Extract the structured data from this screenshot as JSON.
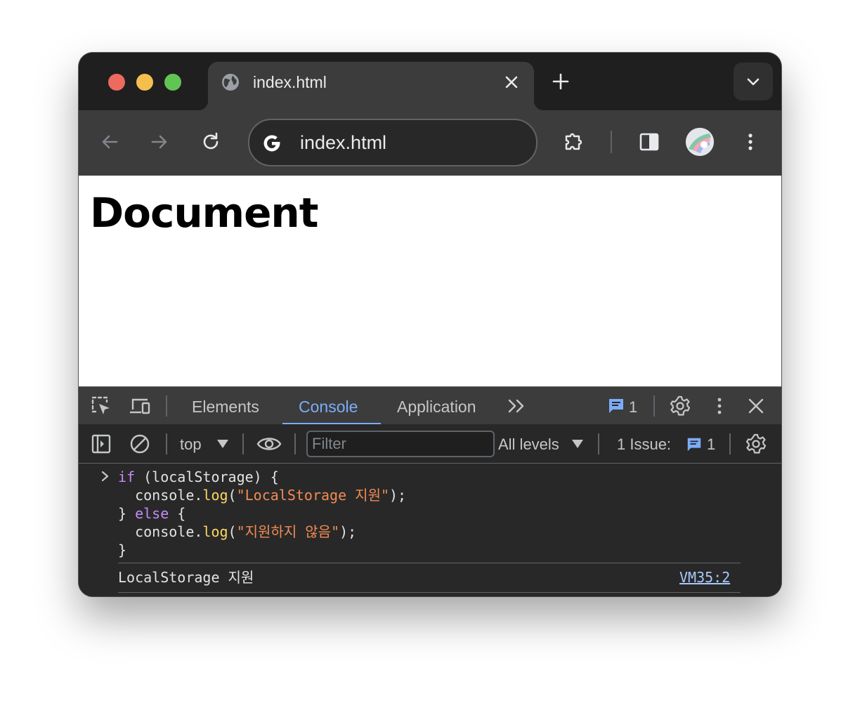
{
  "browser": {
    "tab": {
      "title": "index.html"
    },
    "omnibox": {
      "url": "index.html"
    }
  },
  "page": {
    "heading": "Document"
  },
  "devtools": {
    "tabs": [
      "Elements",
      "Console",
      "Application"
    ],
    "active_tab": "Console",
    "message_count": "1",
    "filterbar": {
      "context": "top",
      "filter_placeholder": "Filter",
      "levels": "All levels",
      "issues_label": "1 Issue:",
      "issues_count": "1"
    },
    "console": {
      "input_code": {
        "line1": {
          "kw": "if",
          "rest": " (localStorage) {"
        },
        "line2": {
          "obj": "  console.",
          "fn": "log",
          "open": "(",
          "str": "\"LocalStorage 지원\"",
          "close": ");"
        },
        "line3": {
          "open": "} ",
          "kw": "else",
          "rest": " {"
        },
        "line4": {
          "obj": "  console.",
          "fn": "log",
          "open": "(",
          "str": "\"지원하지 않음\"",
          "close": ");"
        },
        "line5": "}"
      },
      "output": {
        "text": "LocalStorage 지원",
        "source": "VM35:2"
      }
    }
  },
  "colors": {
    "accent": "#7cacf8",
    "keyword": "#c58af9",
    "function": "#fdd663",
    "string": "#f28b54",
    "link": "#a8c7fa"
  },
  "icons": [
    "globe-icon",
    "close-icon",
    "plus-icon",
    "chevron-down-icon",
    "back-arrow-icon",
    "forward-arrow-icon",
    "reload-icon",
    "google-icon",
    "extensions-icon",
    "side-panel-icon",
    "avatar",
    "more-vert-icon",
    "inspect-icon",
    "device-toolbar-icon",
    "more-tabs-icon",
    "message-icon",
    "gear-icon",
    "sidebar-toggle-icon",
    "clear-icon",
    "eye-icon",
    "caret-down-icon",
    "chevron-right-icon"
  ]
}
